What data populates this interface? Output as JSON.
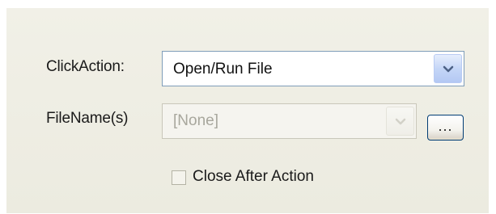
{
  "form": {
    "click_action": {
      "label": "ClickAction:",
      "value": "Open/Run File",
      "enabled": true
    },
    "file_names": {
      "label": "FileName(s)",
      "value": "[None]",
      "enabled": false,
      "browse_label": "..."
    },
    "close_after_action": {
      "label": "Close After Action",
      "checked": false
    }
  },
  "icons": {
    "dropdown": "chevron-down-icon"
  },
  "colors": {
    "panel_background": "#eeede3",
    "field_border": "#7f9db9",
    "dropdown_button": "#c5d6f7",
    "disabled_text": "#a8a79d"
  }
}
